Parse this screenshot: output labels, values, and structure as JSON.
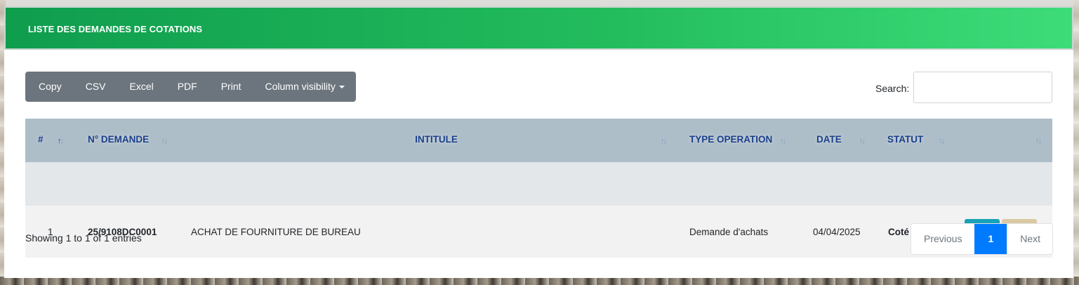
{
  "card": {
    "title": "LISTE DES DEMANDES DE COTATIONS"
  },
  "toolbar": {
    "buttons": [
      "Copy",
      "CSV",
      "Excel",
      "PDF",
      "Print",
      "Column visibility"
    ]
  },
  "search": {
    "label": "Search:",
    "value": "",
    "placeholder": ""
  },
  "table": {
    "columns": [
      "#",
      "N° DEMANDE",
      "INTITULE",
      "TYPE OPERATION",
      "DATE",
      "STATUT",
      ""
    ],
    "rows": [
      {
        "index": "1",
        "numero": "25/9108DC0001",
        "intitule": "ACHAT DE FOURNITURE DE BUREAU",
        "type_operation": "Demande d'achats",
        "date": "04/04/2025",
        "statut": "Coté",
        "actions": [
          "eye-icon",
          "folder-icon"
        ]
      }
    ]
  },
  "footer": {
    "info": "Showing 1 to 1 of 1 entries",
    "pagination": {
      "previous": "Previous",
      "current": "1",
      "next": "Next"
    }
  },
  "colors": {
    "header_gradient_start": "#0f9d4e",
    "header_gradient_end": "#3ddc79",
    "table_header_bg": "#adbec9",
    "table_header_text": "#1b3f8a",
    "statut_color": "#e31b1b",
    "view_button": "#17a2b8",
    "folder_button": "#d9c9a3",
    "pagination_active": "#007bff"
  }
}
